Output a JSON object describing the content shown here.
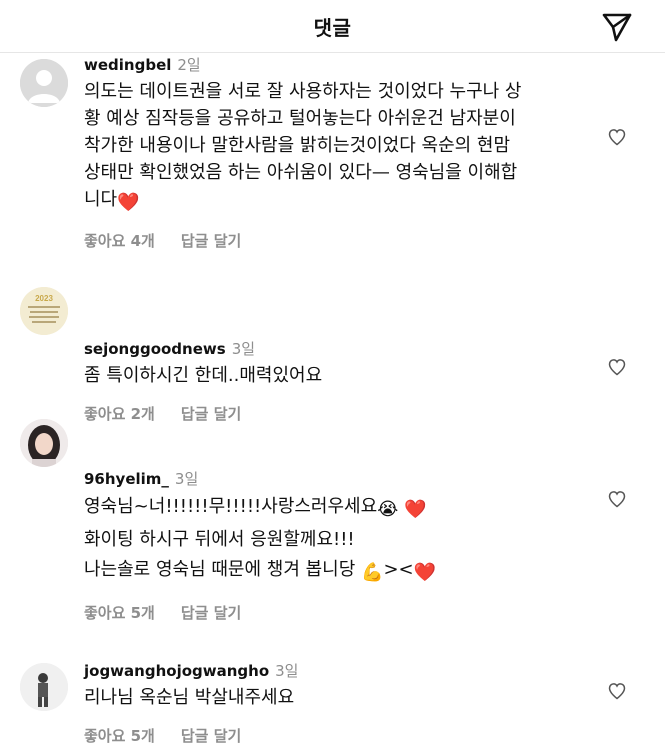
{
  "header": {
    "title": "댓글",
    "send_icon": "paper-plane-icon"
  },
  "comments": [
    {
      "username": "wedingbel",
      "time": "2일",
      "lines": [
        "의도는 데이트권을 서로 잘 사용하자는 것이었다  누구나 상",
        "황 예상 짐작등을 공유하고 털어놓는다  아쉬운건 남자분이",
        "착가한 내용이나 말한사람을 밝히는것이었다  옥순의 현맘",
        "상태만 확인했었음 하는 아쉬움이 있다— 영숙님을 이해합",
        "니다"
      ],
      "emoji_end": "❤️",
      "likes": "좋아요 4개",
      "reply": "답글 달기"
    },
    {
      "username": "sejonggoodnews",
      "time": "3일",
      "lines": [
        "좀 특이하시긴 한데..매력있어요"
      ],
      "likes": "좋아요 2개",
      "reply": "답글 달기",
      "avatar_text": "2023"
    },
    {
      "username": "96hyelim_",
      "time": "3일",
      "lines": [
        "영숙님~너!!!!!!무!!!!!사랑스러우세요",
        "화이팅 하시구 뒤에서 응원할께요!!!",
        "나는솔로 영숙님 때문에 챙겨 봅니당"
      ],
      "line1_emojis": "😭 ❤️",
      "line3_emojis": "💪",
      "line3_tail": "><",
      "line3_heart": "❤️",
      "likes": "좋아요 5개",
      "reply": "답글 달기"
    },
    {
      "username": "jogwanghojogwangho",
      "time": "3일",
      "lines": [
        "리나님 옥순님 박살내주세요"
      ],
      "likes": "좋아요 5개",
      "reply": "답글 달기"
    }
  ],
  "icons": {
    "heart": "heart-outline-icon"
  },
  "colors": {
    "muted": "#8e8e8e",
    "divider": "#e6e6e6",
    "heart_red": "#e0242a"
  }
}
